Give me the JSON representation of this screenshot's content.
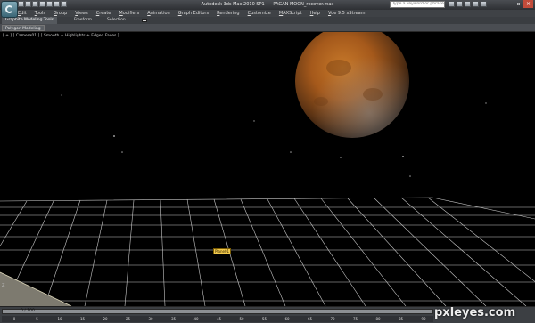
{
  "window": {
    "app_name": "Autodesk 3ds Max  2010 SP1",
    "file_name": "PAGAN MOON_recover.max"
  },
  "search": {
    "placeholder": "Type a keyword or phrase"
  },
  "menu": {
    "items": [
      "Edit",
      "Tools",
      "Group",
      "Views",
      "Create",
      "Modifiers",
      "Animation",
      "Graph Editors",
      "Rendering",
      "Customize",
      "MAXScript",
      "Help",
      "Vue 9.5 xStream"
    ]
  },
  "ribbon": {
    "tabs": [
      "Graphite Modeling Tools",
      "Freeform",
      "Selection"
    ],
    "active_tab": "Graphite Modeling Tools",
    "panel_label": "Polygon Modeling"
  },
  "viewport": {
    "label": "[ + ] [ Camera01 ] [ Smooth + Highlights + Edged Faces ]",
    "object_label": "Plane01",
    "grid_color": "#c8c8c8",
    "moon_color": "#b0611e",
    "axis_label": "Z"
  },
  "timeline": {
    "frame_counter": "0 / 100",
    "ticks": [
      "0",
      "5",
      "10",
      "15",
      "20",
      "25",
      "30",
      "35",
      "40",
      "45",
      "50",
      "55",
      "60",
      "65",
      "70",
      "75",
      "80",
      "85",
      "90"
    ]
  },
  "watermark": "pxleyes.com"
}
